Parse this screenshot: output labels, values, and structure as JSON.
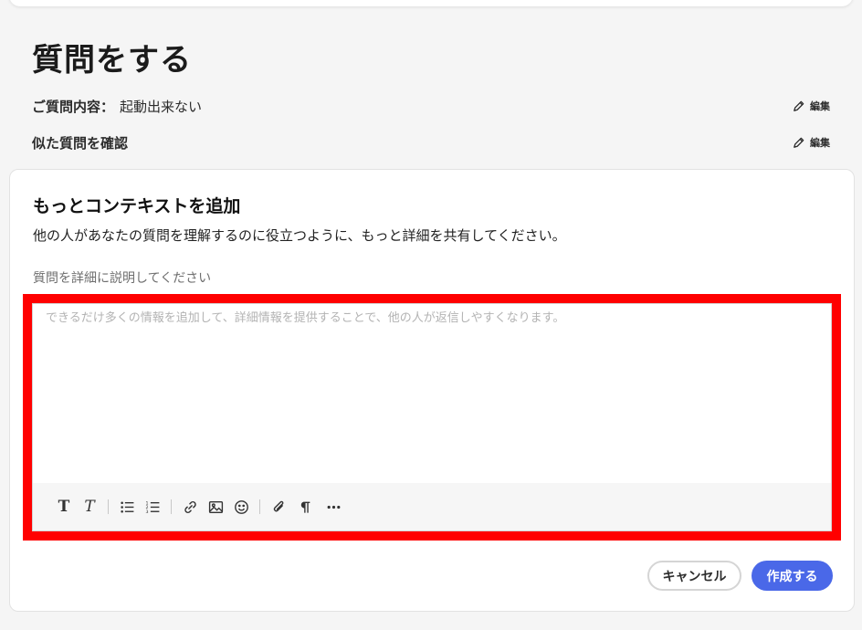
{
  "page": {
    "title": "質問をする"
  },
  "summary": {
    "question_label": "ご質問内容：",
    "question_value": "起動出来ない",
    "similar_label": "似た質問を確認",
    "edit_label": "編集"
  },
  "context": {
    "title": "もっとコンテキストを追加",
    "description": "他の人があなたの質問を理解するのに役立つように、もっと詳細を共有してください。",
    "field_label": "質問を詳細に説明してください",
    "placeholder": "できるだけ多くの情報を追加して、詳細情報を提供することで、他の人が返信しやすくなります。",
    "value": ""
  },
  "toolbar": {
    "tools": [
      "bold-icon",
      "italic-icon",
      "bullet-list-icon",
      "numbered-list-icon",
      "link-icon",
      "image-icon",
      "emoji-icon",
      "attachment-icon",
      "paragraph-icon",
      "more-icon"
    ]
  },
  "actions": {
    "cancel_label": "キャンセル",
    "create_label": "作成する"
  },
  "colors": {
    "primary": "#4a68e8",
    "highlight": "#ff0000"
  }
}
